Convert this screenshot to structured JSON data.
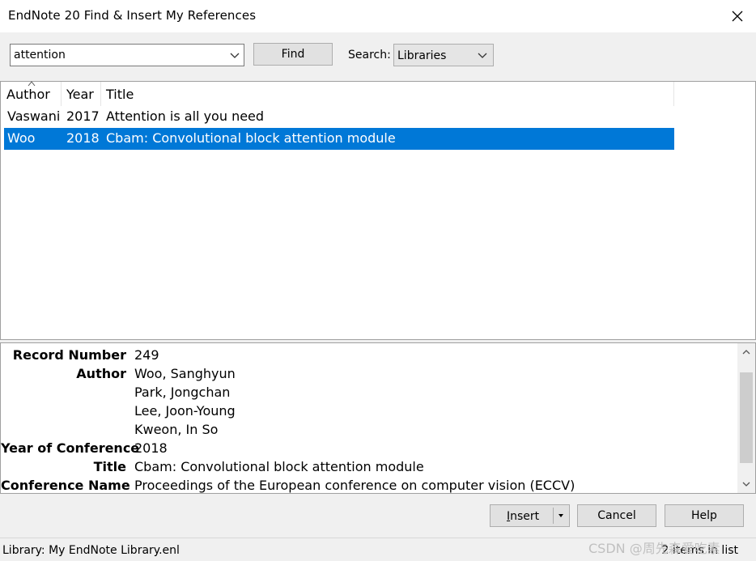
{
  "window": {
    "title": "EndNote 20 Find & Insert My References"
  },
  "search": {
    "query": "attention",
    "find_label": "Find",
    "scope_label": "Search:",
    "scope_value": "Libraries"
  },
  "results": {
    "columns": [
      "Author",
      "Year",
      "Title"
    ],
    "rows": [
      {
        "author": "Vaswani",
        "year": "2017",
        "title": "Attention is all you need"
      },
      {
        "author": "Woo",
        "year": "2018",
        "title": "Cbam: Convolutional block attention module"
      }
    ],
    "selected_index": 1
  },
  "detail": {
    "record_number_label": "Record Number",
    "record_number": "249",
    "author_label": "Author",
    "authors": [
      "Woo, Sanghyun",
      "Park, Jongchan",
      "Lee, Joon-Young",
      "Kweon, In So"
    ],
    "year_label": "Year of Conference",
    "year": "2018",
    "title_label": "Title",
    "title": "Cbam: Convolutional block attention module",
    "conference_label": "Conference Name",
    "conference": "Proceedings of the European conference on computer vision (ECCV)"
  },
  "buttons": {
    "insert_accel": "I",
    "insert_rest": "nsert",
    "cancel": "Cancel",
    "help": "Help"
  },
  "status": {
    "library": "Library: My EndNote Library.enl",
    "count": "2 items in list"
  },
  "watermark": "CSDN @周先森爱吃素",
  "colors": {
    "selection": "#0078d7"
  }
}
